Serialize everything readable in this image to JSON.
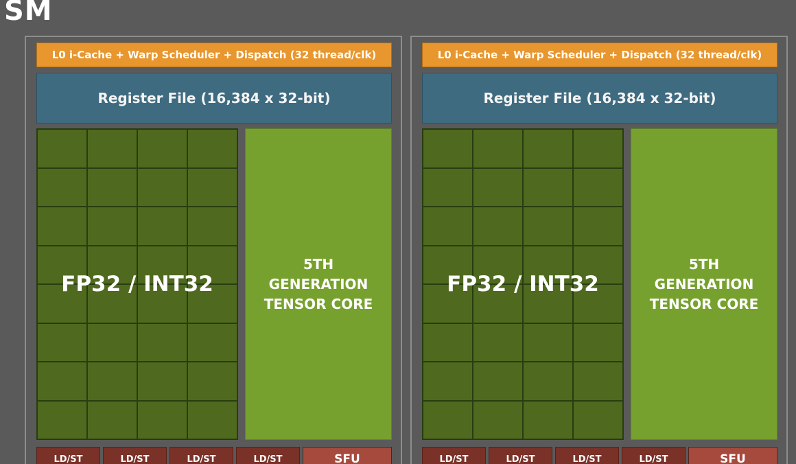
{
  "diagram": {
    "title": "SM",
    "partitions": [
      {
        "warp_scheduler": "L0 i-Cache + Warp Scheduler + Dispatch (32 thread/clk)",
        "register_file": "Register File (16,384 x 32-bit)",
        "fp_block": "FP32 / INT32",
        "tensor_core": [
          "5TH",
          "GENERATION",
          "TENSOR CORE"
        ],
        "units": [
          "LD/ST",
          "LD/ST",
          "LD/ST",
          "LD/ST",
          "SFU"
        ]
      },
      {
        "warp_scheduler": "L0 i-Cache + Warp Scheduler + Dispatch (32 thread/clk)",
        "register_file": "Register File (16,384 x 32-bit)",
        "fp_block": "FP32 / INT32",
        "tensor_core": [
          "5TH",
          "GENERATION",
          "TENSOR CORE"
        ],
        "units": [
          "LD/ST",
          "LD/ST",
          "LD/ST",
          "LD/ST",
          "SFU"
        ]
      }
    ],
    "colors": {
      "background": "#5a5a5a",
      "warp_scheduler": "#e8962e",
      "register_file": "#3f6b80",
      "fp_cores": "#4f6a1f",
      "tensor_core": "#77a12e",
      "ldst": "#7a3128",
      "sfu": "#a64a3e"
    }
  }
}
